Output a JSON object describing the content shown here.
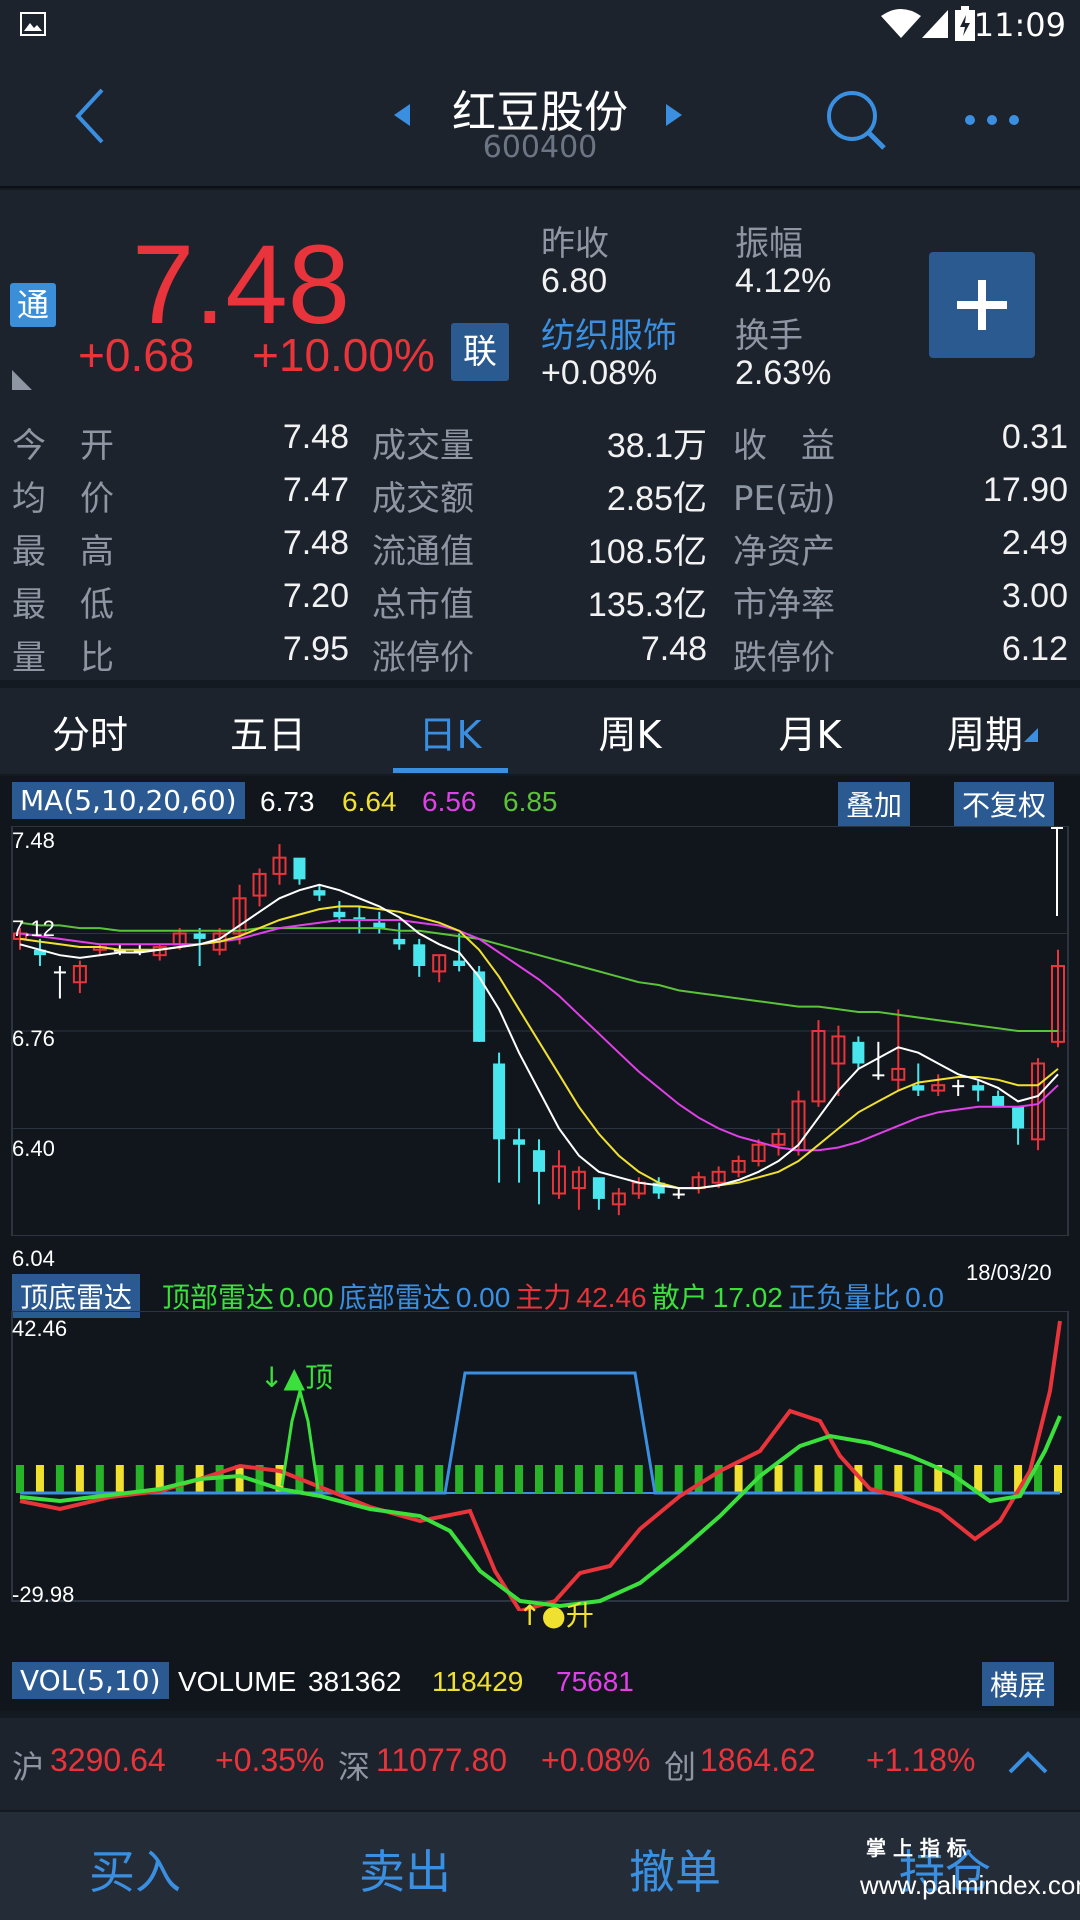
{
  "status": {
    "time": "11:09"
  },
  "header": {
    "title": "红豆股份",
    "code": "600400"
  },
  "quote": {
    "price": "7.48",
    "change": "+0.68",
    "change_pct": "+10.00%",
    "badge_tong": "通",
    "badge_lian": "联",
    "prev_close_label": "昨收",
    "prev_close": "6.80",
    "amplitude_label": "振幅",
    "amplitude": "4.12%",
    "sector": "纺织服饰",
    "sector_change": "+0.08%",
    "turnover_label": "换手",
    "turnover": "2.63%",
    "rows": [
      [
        {
          "l": "今　开",
          "v": "7.48"
        },
        {
          "l": "成交量",
          "v": "38.1万"
        },
        {
          "l": "收　益",
          "v": "0.31"
        }
      ],
      [
        {
          "l": "均　价",
          "v": "7.47"
        },
        {
          "l": "成交额",
          "v": "2.85亿"
        },
        {
          "l": "PE(动)",
          "v": "17.90"
        }
      ],
      [
        {
          "l": "最　高",
          "v": "7.48"
        },
        {
          "l": "流通值",
          "v": "108.5亿"
        },
        {
          "l": "净资产",
          "v": "2.49"
        }
      ],
      [
        {
          "l": "最　低",
          "v": "7.20"
        },
        {
          "l": "总市值",
          "v": "135.3亿"
        },
        {
          "l": "市净率",
          "v": "3.00"
        }
      ],
      [
        {
          "l": "量　比",
          "v": "7.95"
        },
        {
          "l": "涨停价",
          "v": "7.48"
        },
        {
          "l": "跌停价",
          "v": "6.12"
        }
      ]
    ]
  },
  "tabs": [
    "分时",
    "五日",
    "日K",
    "周K",
    "月K",
    "周期"
  ],
  "active_tab": "日K",
  "ma": {
    "label": "MA(5,10,20,60)",
    "v5": "6.73",
    "v10": "6.64",
    "v20": "6.56",
    "v60": "6.85",
    "overlay_btn": "叠加",
    "adjust_btn": "不复权"
  },
  "price_axis": [
    "7.48",
    "7.12",
    "6.76",
    "6.40",
    "6.04"
  ],
  "date_label": "18/03/20",
  "radar": {
    "label": "顶底雷达",
    "top_label": "顶部雷达",
    "top_val": "0.00",
    "bottom_label": "底部雷达",
    "bottom_val": "0.00",
    "main_label": "主力",
    "main_val": "42.46",
    "retail_label": "散户",
    "retail_val": "17.02",
    "ratio_label": "正负量比",
    "ratio_val": "0.0",
    "axis_max": "42.46",
    "axis_min": "-29.98",
    "peak_text": "↓▲顶",
    "rise_text": "↑●升"
  },
  "vol": {
    "label": "VOL(5,10)",
    "name": "VOLUME",
    "v": "381362",
    "v5": "118429",
    "v10": "75681",
    "landscape_btn": "横屏"
  },
  "indices": {
    "sh_label": "沪",
    "sh_val": "3290.64",
    "sh_pct": "+0.35%",
    "sz_label": "深",
    "sz_val": "11077.80",
    "sz_pct": "+0.08%",
    "cy_label": "创",
    "cy_val": "1864.62",
    "cy_pct": "+1.18%"
  },
  "trade": {
    "buy": "买入",
    "sell": "卖出",
    "cancel": "撤单",
    "hold": "持仓"
  },
  "watermark": {
    "line1": "掌 上 指 标",
    "line2": "www.palmindex.com"
  },
  "colors": {
    "up": "#e8343a",
    "accent": "#3b8fe0",
    "ma5": "#ffffff",
    "ma10": "#f0e130",
    "ma20": "#e040e8",
    "ma60": "#5cc23a",
    "down_candle": "#49e6ee"
  },
  "chart_data": {
    "type": "candlestick",
    "price_range": [
      6.04,
      7.48
    ],
    "ohlc": [
      [
        7.1,
        7.14,
        7.06,
        7.12
      ],
      [
        7.06,
        7.1,
        7.0,
        7.04
      ],
      [
        6.98,
        7.0,
        6.88,
        6.98
      ],
      [
        6.94,
        7.02,
        6.9,
        7.0
      ],
      [
        7.06,
        7.08,
        7.04,
        7.07
      ],
      [
        7.06,
        7.08,
        7.04,
        7.06
      ],
      [
        7.06,
        7.08,
        7.04,
        7.06
      ],
      [
        7.04,
        7.08,
        7.02,
        7.07
      ],
      [
        7.08,
        7.14,
        7.06,
        7.12
      ],
      [
        7.12,
        7.14,
        7.0,
        7.1
      ],
      [
        7.06,
        7.14,
        7.04,
        7.12
      ],
      [
        7.12,
        7.3,
        7.08,
        7.25
      ],
      [
        7.26,
        7.36,
        7.22,
        7.34
      ],
      [
        7.34,
        7.45,
        7.3,
        7.4
      ],
      [
        7.4,
        7.36,
        7.3,
        7.32
      ],
      [
        7.28,
        7.3,
        7.24,
        7.26
      ],
      [
        7.2,
        7.24,
        7.16,
        7.18
      ],
      [
        7.18,
        7.22,
        7.12,
        7.17
      ],
      [
        7.16,
        7.2,
        7.12,
        7.14
      ],
      [
        7.1,
        7.16,
        7.06,
        7.08
      ],
      [
        7.08,
        7.1,
        6.96,
        7.0
      ],
      [
        6.98,
        7.04,
        6.94,
        7.04
      ],
      [
        7.02,
        7.12,
        6.98,
        7.0
      ],
      [
        6.98,
        7.0,
        6.72,
        6.72
      ],
      [
        6.64,
        6.68,
        6.2,
        6.36
      ],
      [
        6.36,
        6.4,
        6.2,
        6.34
      ],
      [
        6.32,
        6.36,
        6.12,
        6.24
      ],
      [
        6.16,
        6.32,
        6.14,
        6.26
      ],
      [
        6.18,
        6.26,
        6.1,
        6.24
      ],
      [
        6.22,
        6.2,
        6.1,
        6.14
      ],
      [
        6.12,
        6.18,
        6.08,
        6.16
      ],
      [
        6.16,
        6.22,
        6.14,
        6.2
      ],
      [
        6.2,
        6.22,
        6.14,
        6.16
      ],
      [
        6.16,
        6.18,
        6.14,
        6.16
      ],
      [
        6.18,
        6.24,
        6.16,
        6.22
      ],
      [
        6.2,
        6.26,
        6.18,
        6.24
      ],
      [
        6.24,
        6.3,
        6.22,
        6.28
      ],
      [
        6.28,
        6.36,
        6.26,
        6.34
      ],
      [
        6.34,
        6.4,
        6.3,
        6.38
      ],
      [
        6.32,
        6.54,
        6.3,
        6.5
      ],
      [
        6.5,
        6.8,
        6.48,
        6.76
      ],
      [
        6.64,
        6.78,
        6.52,
        6.74
      ],
      [
        6.72,
        6.74,
        6.62,
        6.64
      ],
      [
        6.6,
        6.72,
        6.58,
        6.6
      ],
      [
        6.58,
        6.84,
        6.54,
        6.62
      ],
      [
        6.56,
        6.64,
        6.52,
        6.54
      ],
      [
        6.54,
        6.6,
        6.52,
        6.56
      ],
      [
        6.56,
        6.58,
        6.52,
        6.56
      ],
      [
        6.56,
        6.58,
        6.5,
        6.54
      ],
      [
        6.52,
        6.54,
        6.48,
        6.48
      ],
      [
        6.48,
        6.46,
        6.34,
        6.4
      ],
      [
        6.36,
        6.66,
        6.32,
        6.64
      ],
      [
        6.72,
        7.06,
        6.7,
        7.0
      ]
    ],
    "ma5": [
      7.08,
      7.06,
      7.04,
      7.03,
      7.04,
      7.05,
      7.05,
      7.06,
      7.07,
      7.08,
      7.1,
      7.15,
      7.2,
      7.25,
      7.28,
      7.3,
      7.28,
      7.25,
      7.22,
      7.18,
      7.12,
      7.08,
      7.05,
      6.96,
      6.84,
      6.68,
      6.54,
      6.4,
      6.3,
      6.24,
      6.22,
      6.2,
      6.19,
      6.18,
      6.18,
      6.19,
      6.21,
      6.24,
      6.28,
      6.34,
      6.44,
      6.54,
      6.62,
      6.66,
      6.7,
      6.68,
      6.64,
      6.6,
      6.58,
      6.55,
      6.5,
      6.52,
      6.6
    ],
    "ma10": [
      7.1,
      7.09,
      7.08,
      7.07,
      7.07,
      7.06,
      7.06,
      7.06,
      7.07,
      7.08,
      7.09,
      7.11,
      7.14,
      7.17,
      7.19,
      7.21,
      7.22,
      7.22,
      7.21,
      7.2,
      7.18,
      7.16,
      7.13,
      7.06,
      6.96,
      6.84,
      6.72,
      6.6,
      6.48,
      6.38,
      6.3,
      6.24,
      6.2,
      6.18,
      6.18,
      6.19,
      6.2,
      6.22,
      6.24,
      6.28,
      6.34,
      6.4,
      6.46,
      6.5,
      6.54,
      6.57,
      6.58,
      6.59,
      6.59,
      6.58,
      6.56,
      6.56,
      6.62
    ],
    "ma20": [
      7.12,
      7.11,
      7.1,
      7.09,
      7.08,
      7.08,
      7.08,
      7.08,
      7.08,
      7.08,
      7.09,
      7.1,
      7.12,
      7.14,
      7.15,
      7.16,
      7.17,
      7.17,
      7.17,
      7.17,
      7.16,
      7.15,
      7.13,
      7.1,
      7.05,
      7.0,
      6.95,
      6.89,
      6.82,
      6.75,
      6.68,
      6.61,
      6.55,
      6.49,
      6.44,
      6.4,
      6.37,
      6.35,
      6.33,
      6.32,
      6.32,
      6.33,
      6.35,
      6.38,
      6.41,
      6.44,
      6.46,
      6.47,
      6.48,
      6.48,
      6.48,
      6.49,
      6.56
    ],
    "ma60": [
      7.16,
      7.15,
      7.15,
      7.14,
      7.14,
      7.13,
      7.13,
      7.13,
      7.13,
      7.13,
      7.13,
      7.13,
      7.14,
      7.14,
      7.14,
      7.14,
      7.14,
      7.14,
      7.14,
      7.13,
      7.13,
      7.12,
      7.11,
      7.1,
      7.08,
      7.06,
      7.04,
      7.02,
      7.0,
      6.98,
      6.96,
      6.94,
      6.93,
      6.91,
      6.9,
      6.89,
      6.88,
      6.87,
      6.86,
      6.85,
      6.85,
      6.84,
      6.83,
      6.83,
      6.82,
      6.81,
      6.8,
      6.79,
      6.78,
      6.77,
      6.76,
      6.76,
      6.76
    ]
  }
}
